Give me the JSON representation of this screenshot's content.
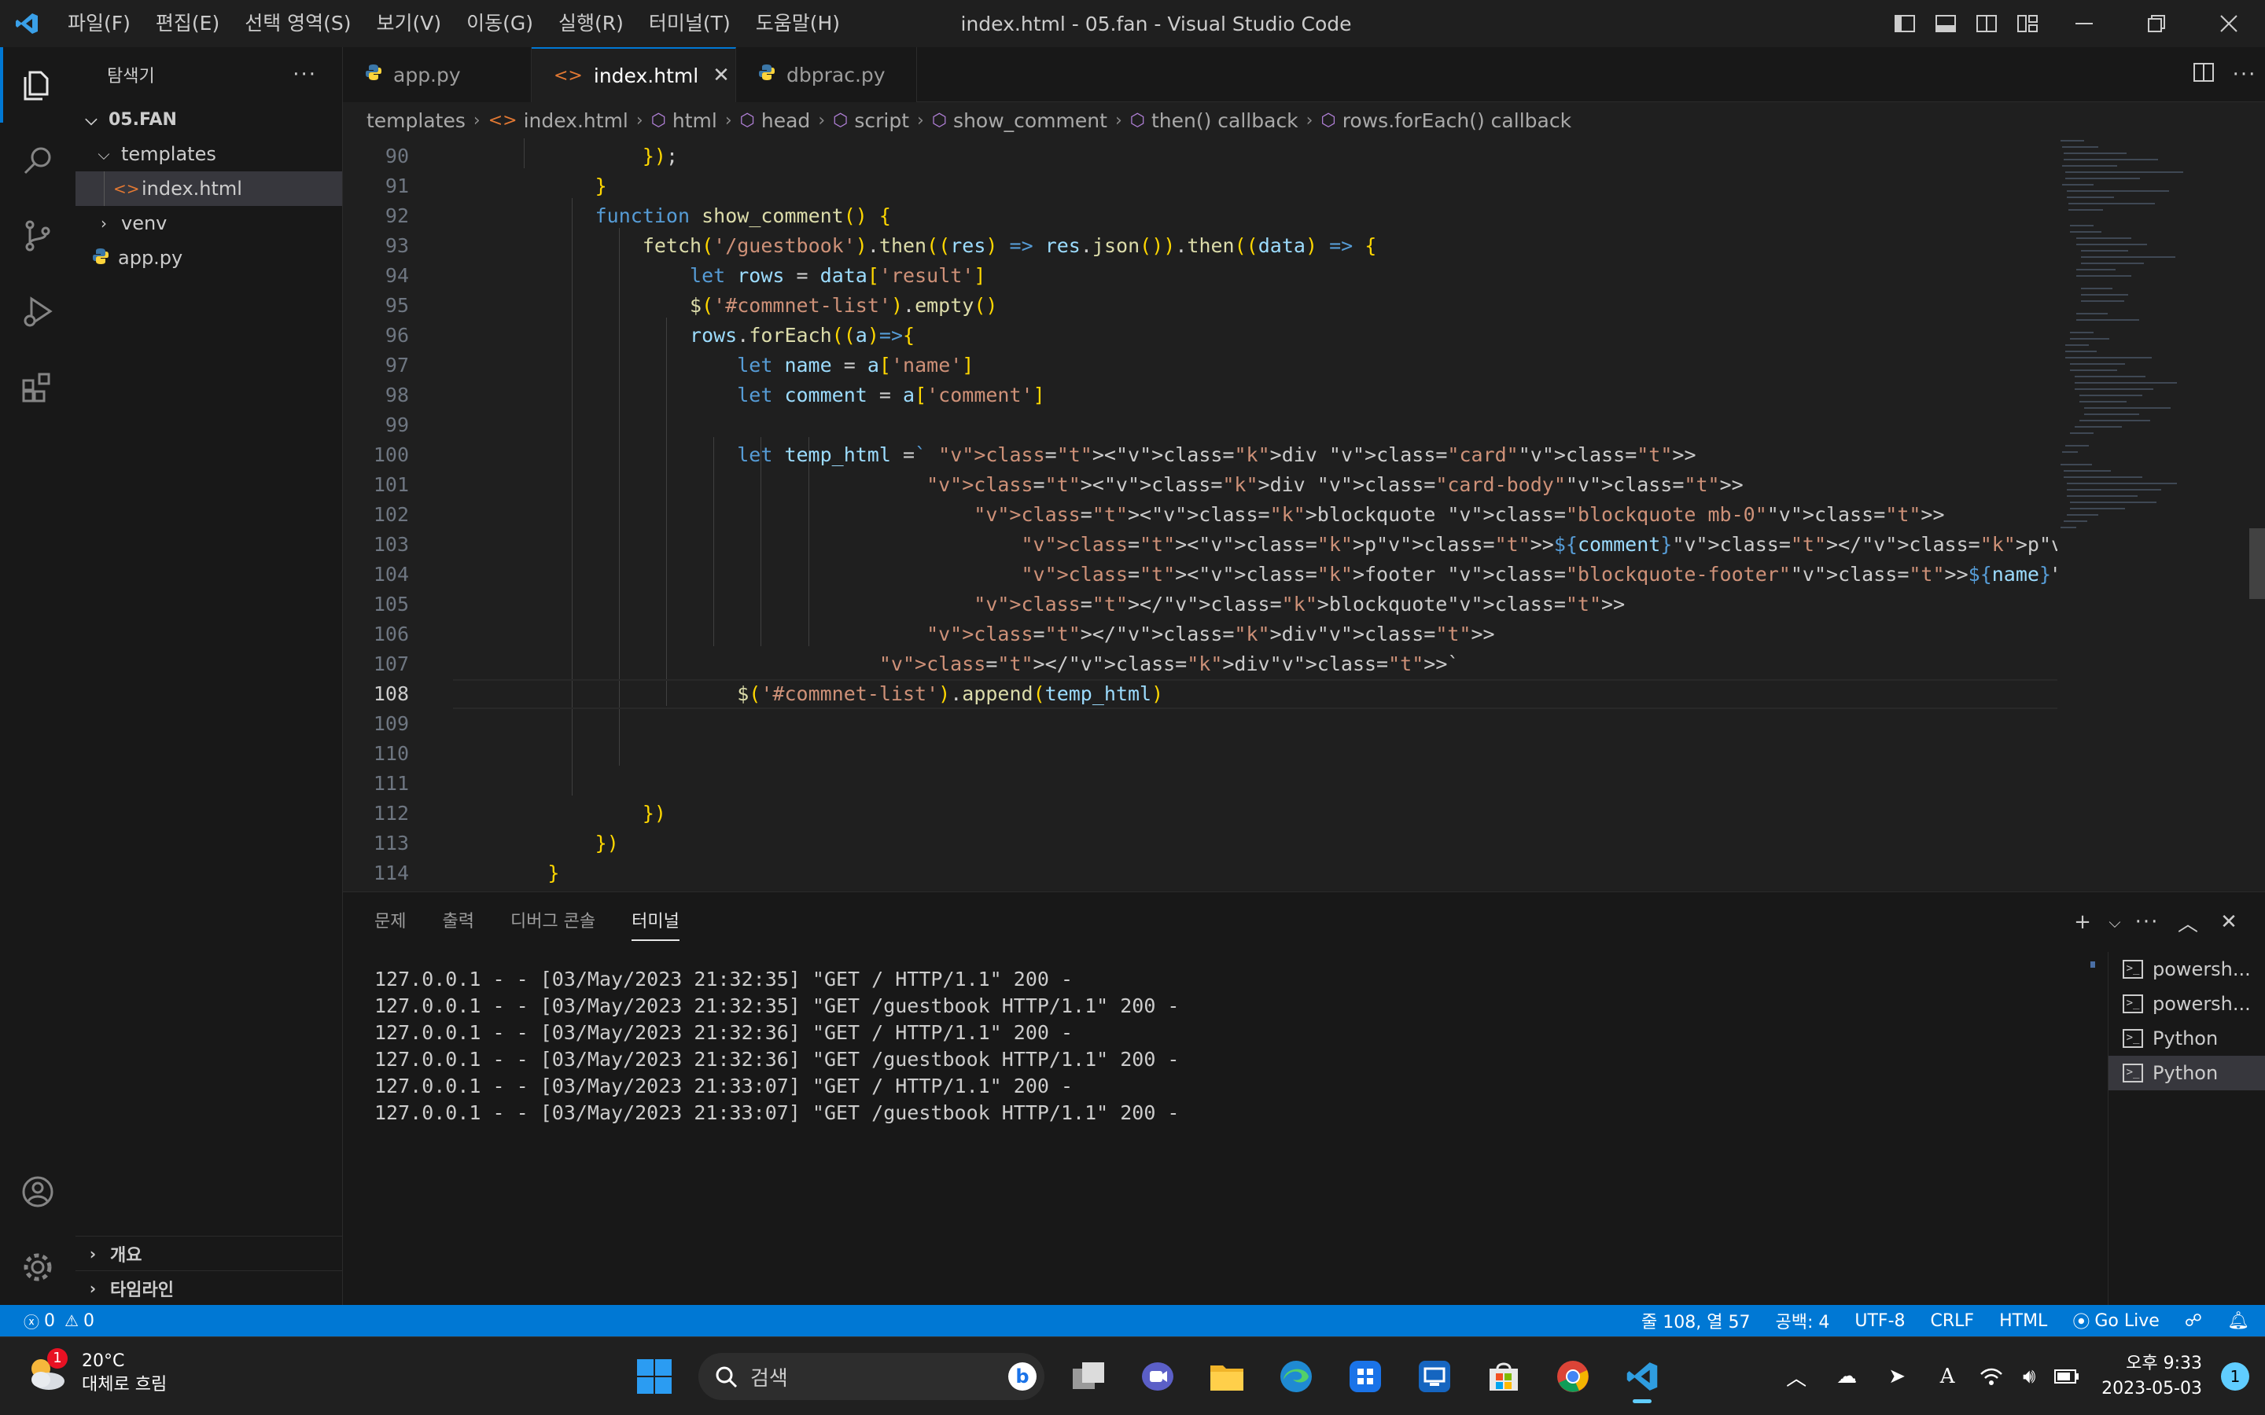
{
  "window": {
    "title": "index.html - 05.fan - Visual Studio Code"
  },
  "menu": [
    "파일(F)",
    "편집(E)",
    "선택 영역(S)",
    "보기(V)",
    "이동(G)",
    "실행(R)",
    "터미널(T)",
    "도움말(H)"
  ],
  "sidebar": {
    "title": "탐색기",
    "root": "05.FAN",
    "items": [
      {
        "label": "templates",
        "type": "folder",
        "expanded": true
      },
      {
        "label": "index.html",
        "type": "html-file"
      },
      {
        "label": "venv",
        "type": "folder",
        "expanded": false
      },
      {
        "label": "app.py",
        "type": "python-file"
      }
    ],
    "sections": [
      "개요",
      "타임라인"
    ]
  },
  "tabs": [
    {
      "label": "app.py",
      "icon": "python-icon",
      "active": false
    },
    {
      "label": "index.html",
      "icon": "html-icon",
      "active": true
    },
    {
      "label": "dbprac.py",
      "icon": "python-icon",
      "active": false
    }
  ],
  "breadcrumb": [
    "templates",
    "index.html",
    "html",
    "head",
    "script",
    "show_comment",
    "then() callback",
    "rows.forEach() callback"
  ],
  "code": {
    "current_line": 108,
    "lines": [
      {
        "n": "90",
        "text": "                });"
      },
      {
        "n": "91",
        "text": "            }"
      },
      {
        "n": "92",
        "text": "            function show_comment() {"
      },
      {
        "n": "93",
        "text": "                fetch('/guestbook').then((res) => res.json()).then((data) => {"
      },
      {
        "n": "94",
        "text": "                    let rows = data['result']"
      },
      {
        "n": "95",
        "text": "                    $('#commnet-list').empty()"
      },
      {
        "n": "96",
        "text": "                    rows.forEach((a)=>{"
      },
      {
        "n": "97",
        "text": "                        let name = a['name']"
      },
      {
        "n": "98",
        "text": "                        let comment = a['comment']"
      },
      {
        "n": "99",
        "text": ""
      },
      {
        "n": "100",
        "text": "                        let temp_html =` <div class=\"card\">"
      },
      {
        "n": "101",
        "text": "                                        <div class=\"card-body\">"
      },
      {
        "n": "102",
        "text": "                                            <blockquote class=\"blockquote mb-0\">"
      },
      {
        "n": "103",
        "text": "                                                <p>${comment}</p>"
      },
      {
        "n": "104",
        "text": "                                                <footer class=\"blockquote-footer\">${name}</footer>"
      },
      {
        "n": "105",
        "text": "                                            </blockquote>"
      },
      {
        "n": "106",
        "text": "                                        </div>"
      },
      {
        "n": "107",
        "text": "                                    </div>`"
      },
      {
        "n": "108",
        "text": "                        $('#commnet-list').append(temp_html)"
      },
      {
        "n": "109",
        "text": ""
      },
      {
        "n": "110",
        "text": ""
      },
      {
        "n": "111",
        "text": ""
      },
      {
        "n": "112",
        "text": "                })"
      },
      {
        "n": "113",
        "text": "            })"
      },
      {
        "n": "114",
        "text": "        }"
      }
    ]
  },
  "panel": {
    "tabs": [
      "문제",
      "출력",
      "디버그 콘솔",
      "터미널"
    ],
    "active_tab": "터미널",
    "terminal_lines": [
      "127.0.0.1 - - [03/May/2023 21:32:35] \"GET / HTTP/1.1\" 200 -",
      "127.0.0.1 - - [03/May/2023 21:32:35] \"GET /guestbook HTTP/1.1\" 200 -",
      "127.0.0.1 - - [03/May/2023 21:32:36] \"GET / HTTP/1.1\" 200 -",
      "127.0.0.1 - - [03/May/2023 21:32:36] \"GET /guestbook HTTP/1.1\" 200 -",
      "127.0.0.1 - - [03/May/2023 21:33:07] \"GET / HTTP/1.1\" 200 -",
      "127.0.0.1 - - [03/May/2023 21:33:07] \"GET /guestbook HTTP/1.1\" 200 -"
    ],
    "terminals": [
      "powersh...",
      "powersh...",
      "Python",
      "Python"
    ]
  },
  "statusbar": {
    "errors": "0",
    "warnings": "0",
    "position": "줄 108, 열 57",
    "spaces": "공백: 4",
    "encoding": "UTF-8",
    "eol": "CRLF",
    "language": "HTML",
    "golive": "Go Live"
  },
  "taskbar": {
    "weather_temp": "20°C",
    "weather_desc": "대체로 흐림",
    "weather_badge": "1",
    "search_placeholder": "검색",
    "time": "오후 9:33",
    "date": "2023-05-03",
    "notifications": "1"
  },
  "colors": {
    "accent": "#0078d4",
    "editor_bg": "#1f1f1f",
    "sidebar_bg": "#181818"
  }
}
